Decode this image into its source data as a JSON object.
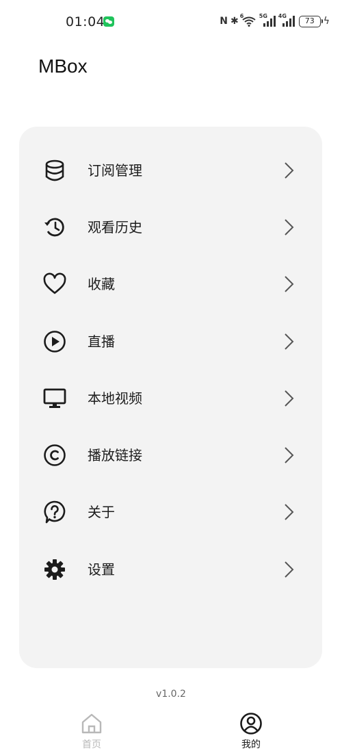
{
  "status_bar": {
    "time": "01:04",
    "nfc": "N",
    "bluetooth": "✱",
    "wifi_tag": "6",
    "sim1_tag": "5G",
    "sim2_tag": "4G",
    "battery_level": "73",
    "icons": [
      "wechat-notification-icon",
      "nfc-icon",
      "bluetooth-icon",
      "wifi-icon",
      "signal-5g-icon",
      "signal-4g-icon",
      "battery-icon",
      "charging-icon"
    ]
  },
  "header": {
    "title": "MBox"
  },
  "menu": {
    "items": [
      {
        "label": "订阅管理",
        "icon": "database-icon"
      },
      {
        "label": "观看历史",
        "icon": "history-icon"
      },
      {
        "label": "收藏",
        "icon": "heart-icon"
      },
      {
        "label": "直播",
        "icon": "play-circle-icon"
      },
      {
        "label": "本地视频",
        "icon": "monitor-icon"
      },
      {
        "label": "播放链接",
        "icon": "copyright-link-icon"
      },
      {
        "label": "关于",
        "icon": "help-bubble-icon"
      },
      {
        "label": "设置",
        "icon": "gear-icon"
      }
    ]
  },
  "footer": {
    "version": "v1.0.2"
  },
  "bottom_nav": {
    "tabs": [
      {
        "label": "首页",
        "icon": "home-icon",
        "active": false
      },
      {
        "label": "我的",
        "icon": "user-circle-icon",
        "active": true
      }
    ]
  },
  "colors": {
    "background": "#ffffff",
    "card": "#f3f3f3",
    "text": "#1c1c1c",
    "muted": "#b8b8b8",
    "wechat_green": "#1fc35b"
  }
}
